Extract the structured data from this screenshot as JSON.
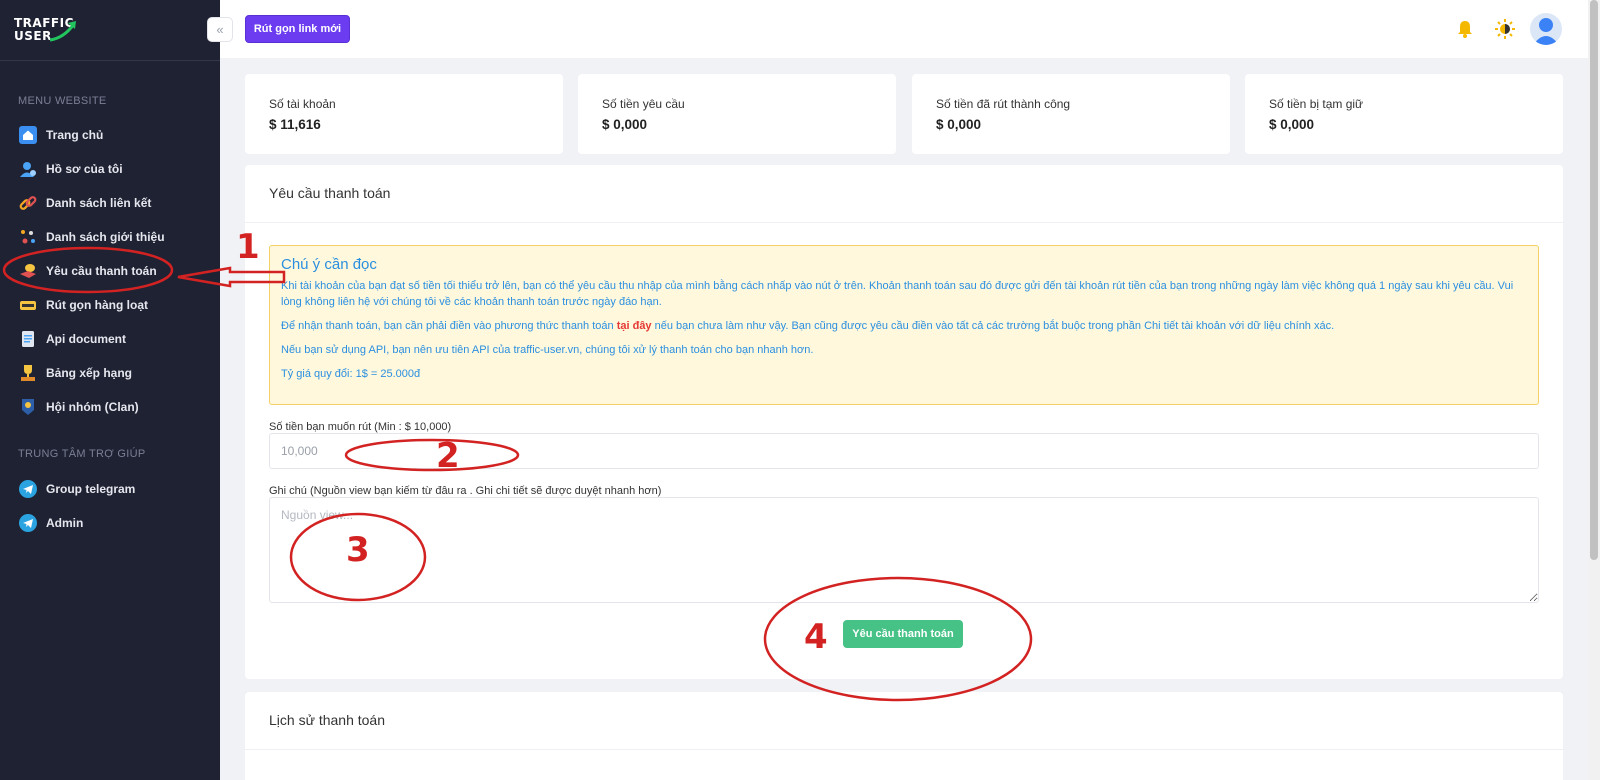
{
  "sidebar": {
    "logo_line1": "TRAFFIC",
    "logo_line2": "USER",
    "section1": "MENU WEBSITE",
    "section2": "TRUNG TÂM TRỢ GIÚP",
    "items": [
      {
        "label": "Trang chủ",
        "icon": "home-icon"
      },
      {
        "label": "Hồ sơ của tôi",
        "icon": "profile-icon"
      },
      {
        "label": "Danh sách liên kết",
        "icon": "link-icon"
      },
      {
        "label": "Danh sách giới thiệu",
        "icon": "referral-icon"
      },
      {
        "label": "Yêu cầu thanh toán",
        "icon": "payment-icon"
      },
      {
        "label": "Rút gọn hàng loạt",
        "icon": "bulk-shorten-icon"
      },
      {
        "label": "Api document",
        "icon": "document-icon"
      },
      {
        "label": "Bảng xếp hạng",
        "icon": "trophy-icon"
      },
      {
        "label": "Hội nhóm (Clan)",
        "icon": "clan-icon"
      }
    ],
    "help_items": [
      {
        "label": "Group telegram",
        "icon": "telegram-icon"
      },
      {
        "label": "Admin",
        "icon": "telegram-icon"
      }
    ]
  },
  "topbar": {
    "new_link_button": "Rút gọn link mới",
    "collapse_glyph": "«"
  },
  "stats": [
    {
      "label": "Số tài khoản",
      "value": "$ 11,616"
    },
    {
      "label": "Số tiền yêu cầu",
      "value": "$ 0,000"
    },
    {
      "label": "Số tiền đã rút thành công",
      "value": "$ 0,000"
    },
    {
      "label": "Số tiền bị tạm giữ",
      "value": "$ 0,000"
    }
  ],
  "payment": {
    "title": "Yêu cầu thanh toán",
    "notice_title": "Chú ý cần đọc",
    "notice_p1": "Khi tài khoản của bạn đạt số tiền tối thiểu trở lên, bạn có thể yêu cầu thu nhập của mình bằng cách nhấp vào nút ở trên. Khoản thanh toán sau đó được gửi đến tài khoản rút tiền của bạn trong những ngày làm việc không quá 1 ngày sau khi yêu cầu. Vui lòng không liên hệ với chúng tôi về các khoản thanh toán trước ngày đáo hạn.",
    "notice_p2_before": "Để nhận thanh toán, bạn cần phải điền vào phương thức thanh toán ",
    "notice_p2_link": "tại đây",
    "notice_p2_after": " nếu bạn chưa làm như vậy. Bạn cũng được yêu cầu điền vào tất cả các trường bắt buộc trong phần Chi tiết tài khoản với dữ liệu chính xác.",
    "notice_p3": "Nếu bạn sử dụng API, bạn nên ưu tiên API của traffic-user.vn, chúng tôi xử lý thanh toán cho bạn nhanh hơn.",
    "notice_p4": "Tỷ giá quy đổi: 1$ = 25.000đ",
    "amount_label": "Số tiền bạn muốn rút (Min : $ 10,000)",
    "amount_placeholder": "10,000",
    "note_label": "Ghi chú (Nguồn view bạn kiếm từ đâu ra . Ghi chi tiết sẽ được duyệt nhanh hơn)",
    "note_placeholder": "Nguồn view...",
    "submit_button": "Yêu cầu thanh toán"
  },
  "history": {
    "title": "Lịch sử thanh toán"
  },
  "annotations": [
    "1",
    "2",
    "3",
    "4"
  ],
  "colors": {
    "sidebar_bg": "#1f2233",
    "primary": "#6c3cf0",
    "success": "#46c287",
    "annotation": "#d32222",
    "alert_text": "#2b8fe0"
  }
}
